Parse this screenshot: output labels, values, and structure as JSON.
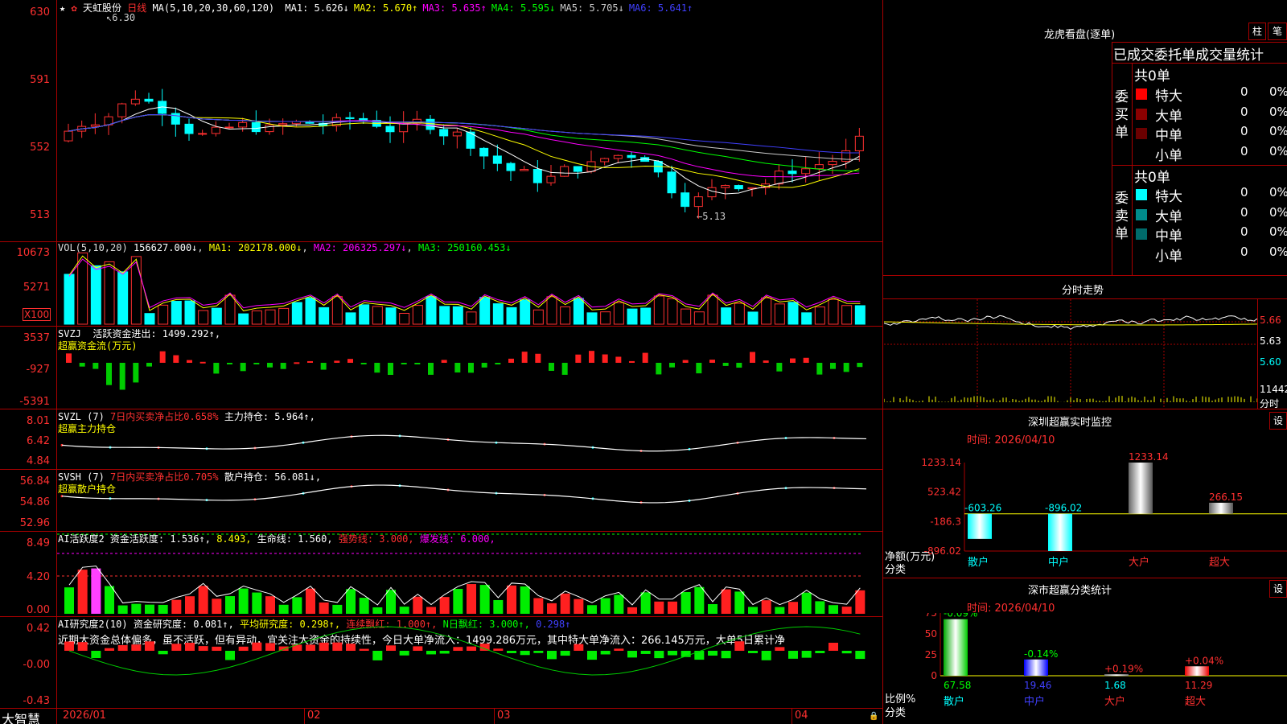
{
  "stock": {
    "title": "天虹股份",
    "period": "日线",
    "ma_header": "MA(5,10,20,30,60,120)",
    "ma": [
      {
        "label": "MA1:",
        "value": "5.626↓",
        "color": "#ffffff"
      },
      {
        "label": "MA2:",
        "value": "5.670↑",
        "color": "#ffff00"
      },
      {
        "label": "MA3:",
        "value": "5.635↑",
        "color": "#ff00ff"
      },
      {
        "label": "MA4:",
        "value": "5.595↓",
        "color": "#00ff00"
      },
      {
        "label": "MA5:",
        "value": "5.705↓",
        "color": "#cccccc"
      },
      {
        "label": "MA6:",
        "value": "5.641↑",
        "color": "#4040ff"
      }
    ],
    "high_mark": "6.30",
    "low_mark": "5.13",
    "price_axis": [
      "630",
      "591",
      "552",
      "513"
    ]
  },
  "volume": {
    "header": "VOL(5,10,20)",
    "value": "156627.000↓",
    "ma1": "MA1: 202178.000↓",
    "ma2": "MA2: 206325.297↓",
    "ma3": "MA3: 250160.453↓",
    "axis": [
      "10673",
      "5271"
    ],
    "unit": "X100"
  },
  "svzj": {
    "header": "SVZJ",
    "label": "活跃资金进出: 1499.292↑,",
    "sub": "超赢资金流(万元)",
    "axis": [
      "3537",
      "-927",
      "-5391"
    ]
  },
  "svzl": {
    "header": "SVZL (7)",
    "ratio": "7日内买卖净占比0.658%",
    "hold": "主力持仓: 5.964↑,",
    "sub": "超赢主力持仓",
    "axis": [
      "8.01",
      "6.42",
      "4.84"
    ]
  },
  "svsh": {
    "header": "SVSH (7)",
    "ratio": "7日内买卖净占比0.705%",
    "hold": "散户持仓: 56.081↓,",
    "sub": "超赢散户持仓",
    "axis": [
      "56.84",
      "54.86",
      "52.96"
    ]
  },
  "ai_active": {
    "header": "AI活跃度2",
    "activity": "资金活跃度: 1.536↑,",
    "v2": "8.493,",
    "life": "生命线: 1.560,",
    "strong": "强势线: 3.000,",
    "burst": "爆发线: 6.000,",
    "axis": [
      "8.49",
      "4.20",
      "0.00"
    ]
  },
  "ai_research": {
    "header": "AI研究度2(10)",
    "research": "资金研究度: 0.081↑,",
    "avg": "平均研究度: 0.298↑,",
    "streak": "连续飘红: 1.000↑,",
    "nday": "N日飘红: 3.000↑,",
    "last": "0.298↑",
    "comment": "近期大资金总体偏多，虽不活跃，但有异动，宜关注大资金的持续性，今日大单净流入：1499.286万元，其中特大单净流入：266.145万元，大单5日累计净",
    "axis": [
      "0.42",
      "-0.00",
      "-0.43"
    ]
  },
  "time_axis": {
    "brand": "大智慧",
    "labels": [
      "2026/01",
      "02",
      "03",
      "04"
    ]
  },
  "dragon": {
    "title": "龙虎看盘(逐单)",
    "btn_zhu": "柱",
    "btn_bi": "笔",
    "header": "已成交委托单成交量统计",
    "buy_total": "共0单",
    "buy_side": "委买单",
    "sell_total": "共0单",
    "sell_side": "委卖单",
    "buy_rows": [
      {
        "name": "特大",
        "count": "0",
        "pct": "0%",
        "color": "#ff0000"
      },
      {
        "name": "大单",
        "count": "0",
        "pct": "0%",
        "color": "#8b0000"
      },
      {
        "name": "中单",
        "count": "0",
        "pct": "0%",
        "color": "#6b0000"
      },
      {
        "name": "小单",
        "count": "0",
        "pct": "0%",
        "color": "#000000"
      }
    ],
    "sell_rows": [
      {
        "name": "特大",
        "count": "0",
        "pct": "0%",
        "color": "#00ffff"
      },
      {
        "name": "大单",
        "count": "0",
        "pct": "0%",
        "color": "#008b8b"
      },
      {
        "name": "中单",
        "count": "0",
        "pct": "0%",
        "color": "#006b6b"
      },
      {
        "name": "小单",
        "count": "0",
        "pct": "0%",
        "color": "#000000"
      }
    ]
  },
  "intraday": {
    "title": "分时走势",
    "prices": [
      "5.66",
      "5.63",
      "5.60"
    ],
    "vol_top": "11442",
    "vol_label": "分时"
  },
  "sz_monitor": {
    "title": "深圳超赢实时监控",
    "btn": "设",
    "time": "时间: 2026/04/10",
    "axis": [
      "1233.14",
      "523.42",
      "-186.3",
      "-896.02"
    ],
    "ylabel": "净额(万元)",
    "xlabel": "分类",
    "categories": [
      "散户",
      "中户",
      "大户",
      "超大"
    ],
    "values": [
      -603.26,
      -896.02,
      1233.14,
      266.15
    ],
    "value_labels": [
      "-603.26",
      "-896.02",
      "1233.14",
      "266.15"
    ]
  },
  "sz_stats": {
    "title": "深市超赢分类统计",
    "btn": "设",
    "time": "时间: 2026/04/10",
    "axis": [
      "75",
      "50",
      "25",
      "0"
    ],
    "ylabel": "比例%",
    "xlabel": "分类",
    "categories": [
      "散户",
      "中户",
      "大户",
      "超大"
    ],
    "values": [
      67.58,
      19.46,
      1.68,
      11.29
    ],
    "value_labels": [
      "67.58",
      "19.46",
      "1.68",
      "11.29"
    ],
    "changes": [
      "-0.09%",
      "-0.14%",
      "+0.19%",
      "+0.04%"
    ]
  }
}
